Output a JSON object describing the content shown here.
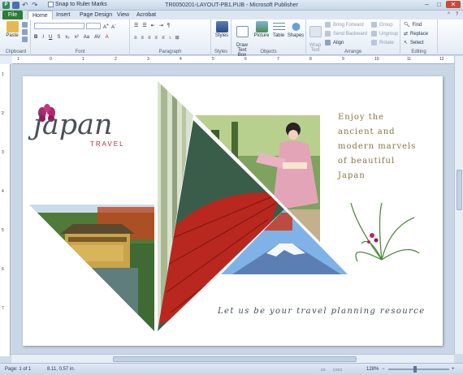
{
  "window": {
    "title": "TR0050201-LAYOUT-PB1.PUB - Microsoft Publisher",
    "snap_label": "Snap to Ruler Marks"
  },
  "tabs": [
    "File",
    "Home",
    "Insert",
    "Page Design",
    "View",
    "Acrobat"
  ],
  "ribbon": {
    "clipboard": {
      "label": "Clipboard",
      "paste": "Paste"
    },
    "font": {
      "label": "Font"
    },
    "paragraph": {
      "label": "Paragraph"
    },
    "styles": {
      "label": "Styles",
      "button": "Styles"
    },
    "objects": {
      "label": "Objects",
      "draw_text_box": "Draw\nText Box",
      "picture": "Picture",
      "table": "Table",
      "shapes": "Shapes"
    },
    "arrange": {
      "label": "Arrange",
      "wrap_text": "Wrap\nText",
      "bring_forward": "Bring Forward",
      "send_backward": "Send Backward",
      "align": "Align",
      "group": "Group",
      "ungroup": "Ungroup",
      "rotate": "Rotate"
    },
    "editing": {
      "label": "Editing",
      "find": "Find",
      "replace": "Replace",
      "select": "Select"
    }
  },
  "ruler_h_ticks": [
    "1",
    "0",
    "1",
    "2",
    "3",
    "4",
    "5",
    "6",
    "7",
    "8",
    "9",
    "10",
    "11",
    "12"
  ],
  "ruler_v_ticks": [
    "1",
    "2",
    "3",
    "4",
    "5",
    "6",
    "7"
  ],
  "document": {
    "logo_word": "japan",
    "logo_sub": "TRAVEL",
    "headline": "Enjoy the\nancient and\nmodern marvels\nof beautiful\nJapan",
    "tagline": "Let us be your travel planning resource"
  },
  "status": {
    "page": "Page: 1 of 1",
    "position": "8.11, 0.57 in.",
    "zoom": "128%"
  },
  "colors": {
    "accent_red": "#c4283c",
    "headline_gold": "#8a7440",
    "file_tab": "#2e7d32",
    "orchid_magenta": "#b0286e"
  }
}
